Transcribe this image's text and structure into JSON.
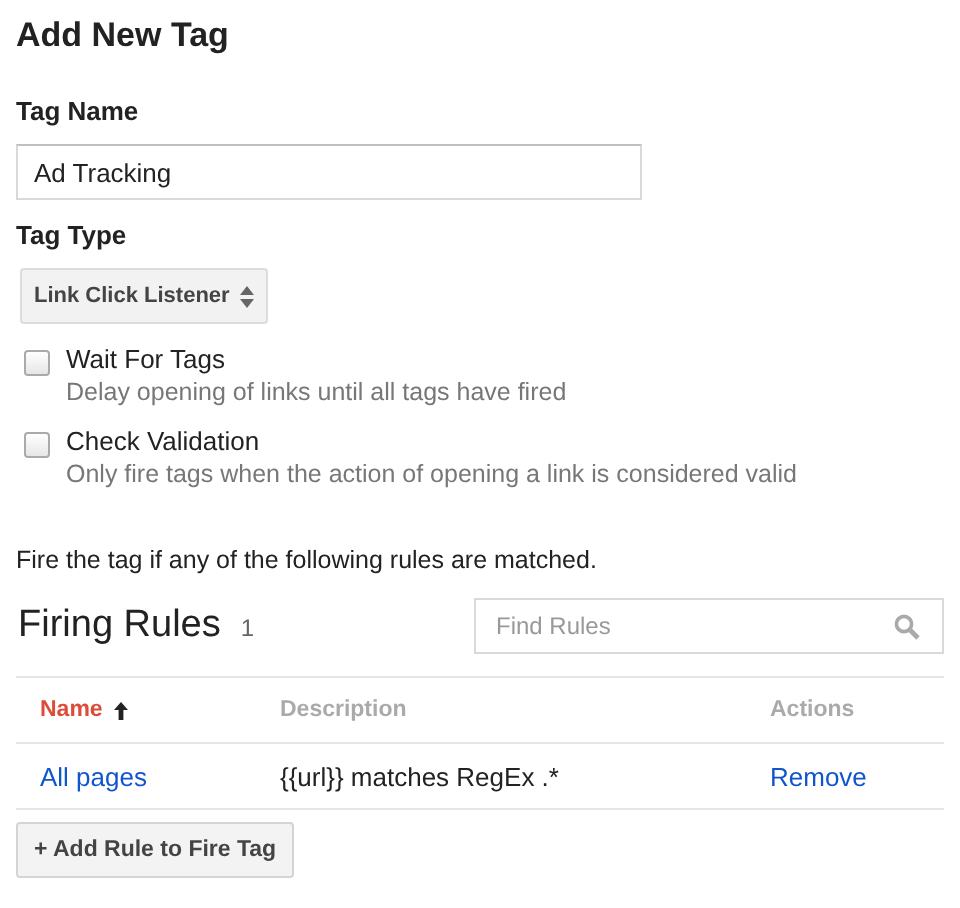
{
  "title": "Add New Tag",
  "tag_name": {
    "label": "Tag Name",
    "value": "Ad Tracking"
  },
  "tag_type": {
    "label": "Tag Type",
    "value": "Link Click Listener"
  },
  "options": [
    {
      "label": "Wait For Tags",
      "hint": "Delay opening of links until all tags have fired",
      "checked": false
    },
    {
      "label": "Check Validation",
      "hint": "Only fire tags when the action of opening a link is considered valid",
      "checked": false
    }
  ],
  "rules_intro": "Fire the tag if any of the following rules are matched.",
  "firing_rules": {
    "title": "Firing Rules",
    "count": "1",
    "search": {
      "placeholder": "Find Rules"
    },
    "columns": [
      {
        "label": "Name",
        "selected": true
      },
      {
        "label": "Description",
        "selected": false
      },
      {
        "label": "Actions",
        "selected": false
      }
    ],
    "rows": [
      {
        "name": "All pages",
        "description": "{{url}} matches RegEx .*",
        "action": "Remove"
      }
    ],
    "add_button": "+ Add Rule to Fire Tag"
  }
}
